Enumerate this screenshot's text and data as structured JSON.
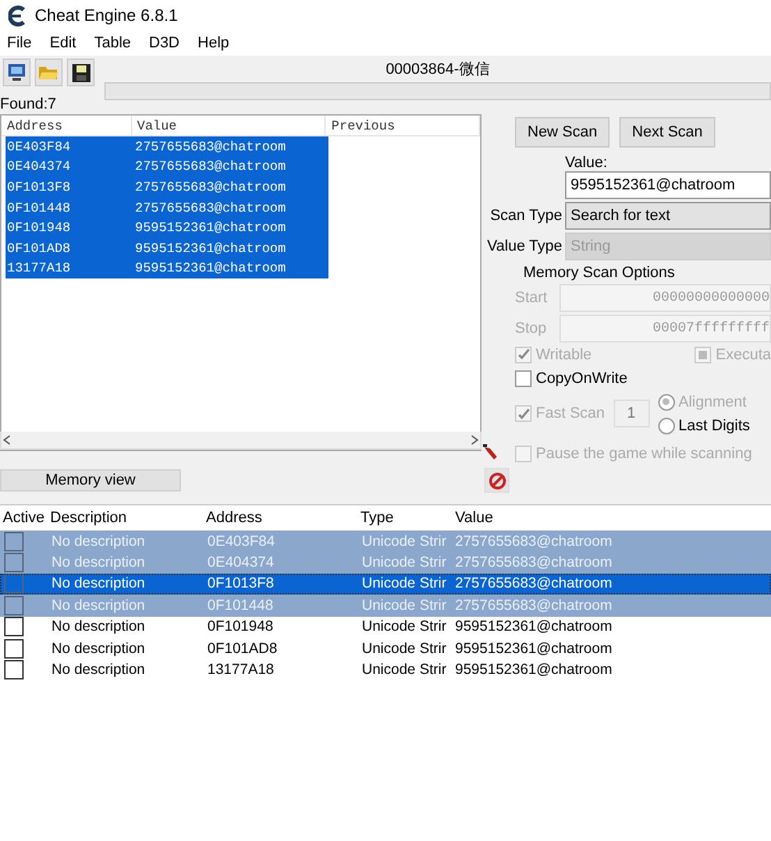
{
  "window": {
    "title": "Cheat Engine 6.8.1"
  },
  "menu": [
    "File",
    "Edit",
    "Table",
    "D3D",
    "Help"
  ],
  "process": {
    "title": "00003864-微信",
    "level": 0
  },
  "found": "Found:7",
  "found_list": {
    "columns": [
      "Address",
      "Value",
      "Previous"
    ],
    "rows": [
      {
        "address": "0E403F84",
        "value": "2757655683@chatroom",
        "selected": true
      },
      {
        "address": "0E404374",
        "value": "2757655683@chatroom",
        "selected": true
      },
      {
        "address": "0F1013F8",
        "value": "2757655683@chatroom",
        "selected": true
      },
      {
        "address": "0F101448",
        "value": "2757655683@chatroom",
        "selected": true
      },
      {
        "address": "0F101948",
        "value": "9595152361@chatroom",
        "selected": true
      },
      {
        "address": "0F101AD8",
        "value": "9595152361@chatroom",
        "selected": true
      },
      {
        "address": "13177A18",
        "value": "9595152361@chatroom",
        "selected": true
      }
    ]
  },
  "scan": {
    "new_scan": "New Scan",
    "next_scan": "Next Scan",
    "value_label": "Value:",
    "value": "9595152361@chatroom",
    "scan_type_label": "Scan Type",
    "scan_type": "Search for text",
    "scan_type_disabled": false,
    "value_type_label": "Value Type",
    "value_type": "String",
    "value_type_disabled": true,
    "options_title": "Memory Scan Options",
    "start_label": "Start",
    "start": "00000000000000",
    "stop_label": "Stop",
    "stop": "00007fffffffff",
    "writable": {
      "label": "Writable",
      "checked": true,
      "disabled": true
    },
    "executable": {
      "label": "Executa",
      "checked": false,
      "partial": true,
      "disabled": true
    },
    "copy_on_write": {
      "label": "CopyOnWrite",
      "checked": false,
      "disabled": false
    },
    "fast_scan": {
      "label": "Fast Scan",
      "checked": true,
      "disabled": true
    },
    "fast_scan_value": "1",
    "alignment": {
      "label": "Alignment",
      "selected": true,
      "disabled": true
    },
    "last_digits": {
      "label": "Last Digits",
      "selected": false,
      "disabled": false
    },
    "pause": {
      "label": "Pause the game while scanning",
      "checked": false,
      "disabled": true
    }
  },
  "memory_view": "Memory view",
  "cheat_table": {
    "columns": [
      "Active",
      "Description",
      "Address",
      "Type",
      "Value"
    ],
    "rows": [
      {
        "active": false,
        "description": "No description",
        "address": "0E403F84",
        "type": "Unicode Strir",
        "value": "2757655683@chatroom",
        "selected": true,
        "focused": false
      },
      {
        "active": false,
        "description": "No description",
        "address": "0E404374",
        "type": "Unicode Strir",
        "value": "2757655683@chatroom",
        "selected": true,
        "focused": false
      },
      {
        "active": false,
        "description": "No description",
        "address": "0F1013F8",
        "type": "Unicode Strir",
        "value": "2757655683@chatroom",
        "selected": true,
        "focused": true
      },
      {
        "active": false,
        "description": "No description",
        "address": "0F101448",
        "type": "Unicode Strir",
        "value": "2757655683@chatroom",
        "selected": true,
        "focused": false
      },
      {
        "active": false,
        "description": "No description",
        "address": "0F101948",
        "type": "Unicode Strir",
        "value": "9595152361@chatroom",
        "selected": false,
        "focused": false
      },
      {
        "active": false,
        "description": "No description",
        "address": "0F101AD8",
        "type": "Unicode Strir",
        "value": "9595152361@chatroom",
        "selected": false,
        "focused": false
      },
      {
        "active": false,
        "description": "No description",
        "address": "13177A18",
        "type": "Unicode Strir",
        "value": "9595152361@chatroom",
        "selected": false,
        "focused": false
      }
    ]
  }
}
